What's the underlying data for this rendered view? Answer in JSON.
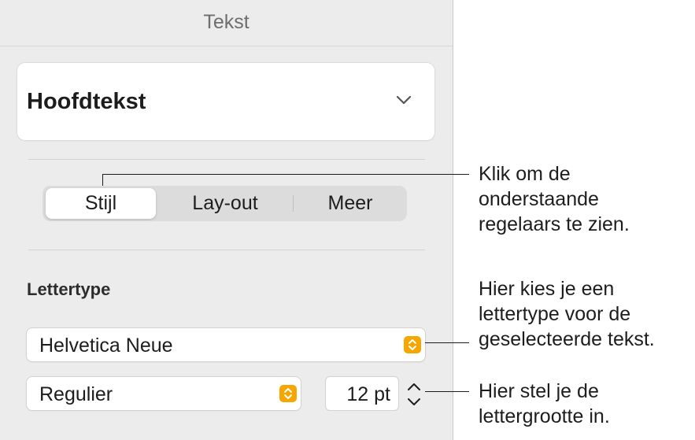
{
  "header": {
    "title": "Tekst"
  },
  "paragraph_style": {
    "value": "Hoofdtekst"
  },
  "tabs": [
    {
      "label": "Stijl",
      "active": true
    },
    {
      "label": "Lay-out",
      "active": false
    },
    {
      "label": "Meer",
      "active": false
    }
  ],
  "font_section": {
    "label": "Lettertype"
  },
  "font_family": {
    "value": "Helvetica Neue"
  },
  "font_style": {
    "value": "Regulier"
  },
  "font_size": {
    "value": "12 pt"
  },
  "callouts": {
    "tabs": "Klik om de\nonderstaande\nregelaars te zien.",
    "font": "Hier kies je een\nlettertype voor de\ngeselecteerde tekst.",
    "size": "Hier stel je de\nlettergrootte in."
  },
  "colors": {
    "accent": "#f7a600",
    "panel": "#ececec",
    "segment_bg": "#dcdcdc"
  }
}
